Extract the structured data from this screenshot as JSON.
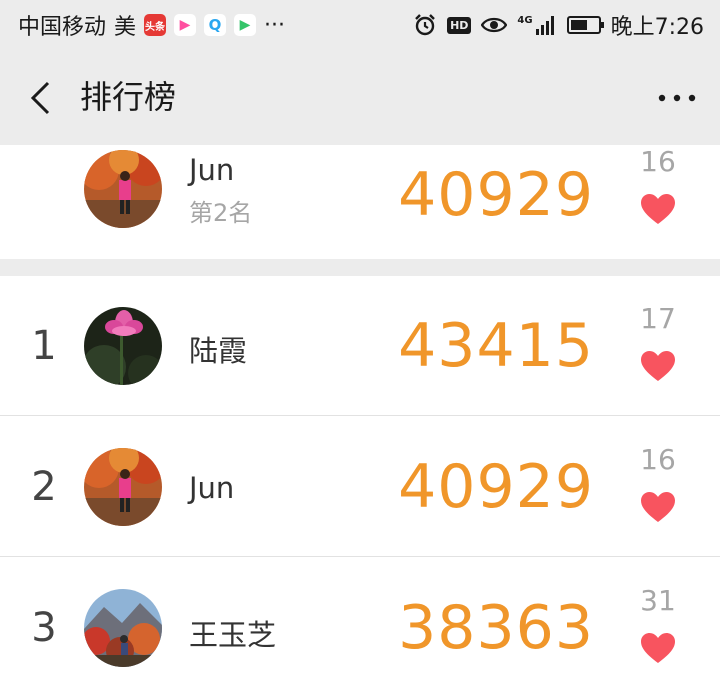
{
  "status_bar": {
    "carrier": "中国移动",
    "carrier_suffix": "美",
    "app_icons": [
      {
        "name": "toutiao-app-icon",
        "text": "头条",
        "color": "#e53935"
      },
      {
        "name": "video-app-icon",
        "text": "▶",
        "color": "#ff4fa0"
      },
      {
        "name": "browser-app-icon",
        "text": "Q",
        "color": "#2aa7f0"
      },
      {
        "name": "player-app-icon",
        "text": "▶",
        "color": "#35c46a"
      }
    ],
    "overflow_dots": "···",
    "hd_label": "HD",
    "network_label": "4G",
    "battery_level": 0.6,
    "time": "晚上7:26"
  },
  "nav": {
    "title": "排行榜"
  },
  "my_entry": {
    "name": "Jun",
    "rank_label": "第2名",
    "steps": "40929",
    "likes": "16"
  },
  "rankings": [
    {
      "rank": "1",
      "name": "陆霞",
      "steps": "43415",
      "likes": "17"
    },
    {
      "rank": "2",
      "name": "Jun",
      "steps": "40929",
      "likes": "16"
    },
    {
      "rank": "3",
      "name": "王玉芝",
      "steps": "38363",
      "likes": "31"
    }
  ],
  "colors": {
    "accent_steps": "#f0962a",
    "heart": "#f8545f",
    "header_bg": "#ececec"
  }
}
